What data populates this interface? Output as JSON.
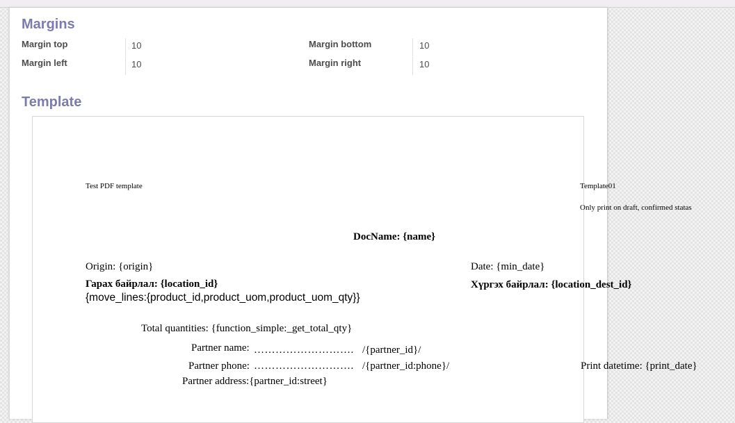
{
  "margins": {
    "title": "Margins",
    "fields": [
      {
        "label": "Margin top",
        "value": "10"
      },
      {
        "label": "Margin bottom",
        "value": "10"
      },
      {
        "label": "Margin left",
        "value": "10"
      },
      {
        "label": "Margin right",
        "value": "10"
      }
    ]
  },
  "template": {
    "title": "Template",
    "doc": {
      "header_left": "Test PDF template",
      "header_right": "Template01",
      "header_note": "Only print on draft, confirmed statas",
      "doc_name": "DocName: {name}",
      "origin": "Origin: {origin}",
      "date": "Date: {min_date}",
      "location": "Гарах байрлал: {location_id}",
      "location_dest": "Хүргэх байрлал: {location_dest_id}",
      "move_lines": "{move_lines:{product_id,product_uom,product_uom_qty}}",
      "total": "Total quantities: {function_simple:_get_total_qty}",
      "partner_name_label": "Partner name:",
      "partner_name_dots": "……………………….",
      "partner_name_value": "/{partner_id}/",
      "partner_phone_label": "Partner phone:",
      "partner_phone_dots": "……………………….",
      "partner_phone_value": "/{partner_id:phone}/",
      "print_datetime": "Print datetime: {print_date}",
      "partner_address": "Partner address:{partner_id:street}"
    }
  }
}
